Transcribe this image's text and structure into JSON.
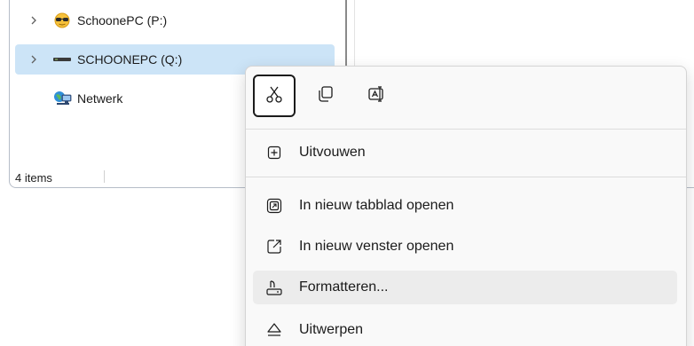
{
  "navigation": {
    "items": [
      {
        "label": "SchoonePC (P:)",
        "icon": "network-drive-sunglasses-icon",
        "has_chevron": true
      },
      {
        "label": "SCHOONEPC (Q:)",
        "icon": "drive-icon",
        "has_chevron": true,
        "selected": true
      },
      {
        "label": "Netwerk",
        "icon": "network-icon",
        "has_chevron": false
      }
    ]
  },
  "status_bar": {
    "item_count": "4 items"
  },
  "context_menu": {
    "quick_actions": [
      {
        "name": "cut",
        "icon": "scissors-icon",
        "focused": true
      },
      {
        "name": "copy",
        "icon": "copy-icon"
      },
      {
        "name": "rename",
        "icon": "rename-icon"
      }
    ],
    "items": [
      {
        "label": "Uitvouwen",
        "icon": "expand-plus-icon"
      },
      {
        "label": "In nieuw tabblad openen",
        "icon": "new-tab-icon"
      },
      {
        "label": "In nieuw venster openen",
        "icon": "new-window-icon"
      },
      {
        "label": "Formatteren...",
        "icon": "format-drive-icon",
        "hovered": true
      },
      {
        "label": "Uitwerpen",
        "icon": "eject-icon"
      }
    ]
  },
  "colors": {
    "selection": "#cce4f7",
    "menu_background": "#f9f9f9",
    "hover": "#ececec",
    "accent": "#005fb8"
  }
}
